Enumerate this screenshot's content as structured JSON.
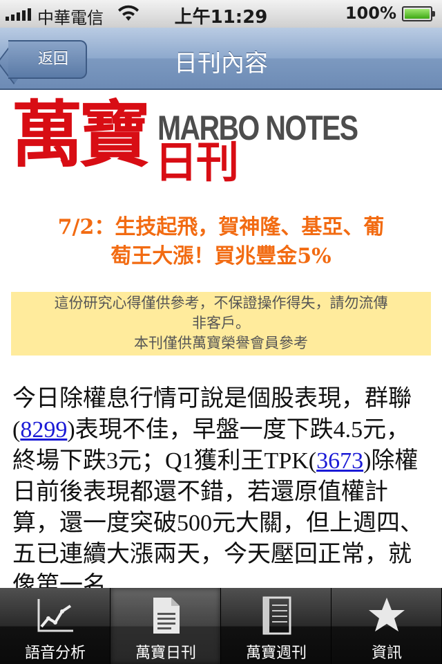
{
  "status_bar": {
    "carrier": "中華電信",
    "time": "上午11:29",
    "battery": "100%"
  },
  "nav": {
    "back_label": "返回",
    "title": "日刊內容"
  },
  "logo": {
    "cjk_main": "萬寶",
    "cjk_sub": "日刊",
    "latin": "MARBO NOTES"
  },
  "headline": {
    "line1": "7/2：生技起飛，賀神隆、基亞、葡",
    "line2": "萄王大漲！買兆豐金5%"
  },
  "notice": {
    "line1": "這份研究心得僅供參考，不保證操作得失，請勿流傳",
    "line2": "非客戶。",
    "line3": "本刊僅供萬寶榮譽會員參考"
  },
  "article": {
    "p1": "今日除權息行情可說是個股表現，群聯(",
    "link1": "8299",
    "p2": ")表現不佳，早盤一度下跌4.5元，終場下跌3元；Q1獲利王TPK(",
    "link2": "3673",
    "p3": ")除權日前後表現都還不錯，若還原值權計算，還一度突破500元大關，但上週四、五已連續大漲兩天，今天壓回正常，就像第一名"
  },
  "tabs": [
    {
      "label": "語音分析",
      "icon": "chart-icon"
    },
    {
      "label": "萬寶日刊",
      "icon": "document-icon"
    },
    {
      "label": "萬寶週刊",
      "icon": "notebook-icon"
    },
    {
      "label": "資訊",
      "icon": "star-icon"
    }
  ],
  "colors": {
    "logo_red": "#d80d14",
    "headline_orange": "#f26b12",
    "notice_bg": "#ffeb9c",
    "link_blue": "#1a1ad6"
  }
}
